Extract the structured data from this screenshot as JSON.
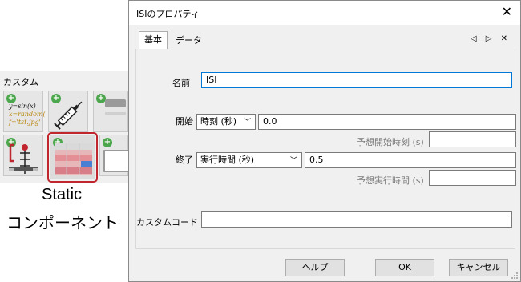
{
  "builder": {
    "section_label": "カスタム",
    "code_tile": {
      "lines": [
        "y=sin(x)",
        "x=random(",
        "f='tst.jpg'"
      ]
    },
    "static_caption": {
      "line1": "Static",
      "line2": "コンポーネント"
    }
  },
  "dialog": {
    "title": "ISIのプロパティ",
    "tabs": [
      "基本",
      "データ"
    ],
    "tab_arrows": "◁ ▷ ✕",
    "fields": {
      "name_label": "名前",
      "name_value": "ISI",
      "start_label": "開始",
      "start_type": "時刻 (秒)",
      "start_value": "0.0",
      "expected_start_label": "予想開始時刻 (s)",
      "expected_start_value": "",
      "end_label": "終了",
      "end_type": "実行時間 (秒)",
      "end_value": "0.5",
      "expected_duration_label": "予想実行時間 (s)",
      "expected_duration_value": "",
      "custom_code_label": "カスタムコード $",
      "custom_code_value": ""
    },
    "buttons": {
      "help": "ヘルプ",
      "ok": "OK",
      "cancel": "キャンセル"
    }
  },
  "colors": {
    "highlight": "#c0262d",
    "focus": "#0078d7"
  }
}
